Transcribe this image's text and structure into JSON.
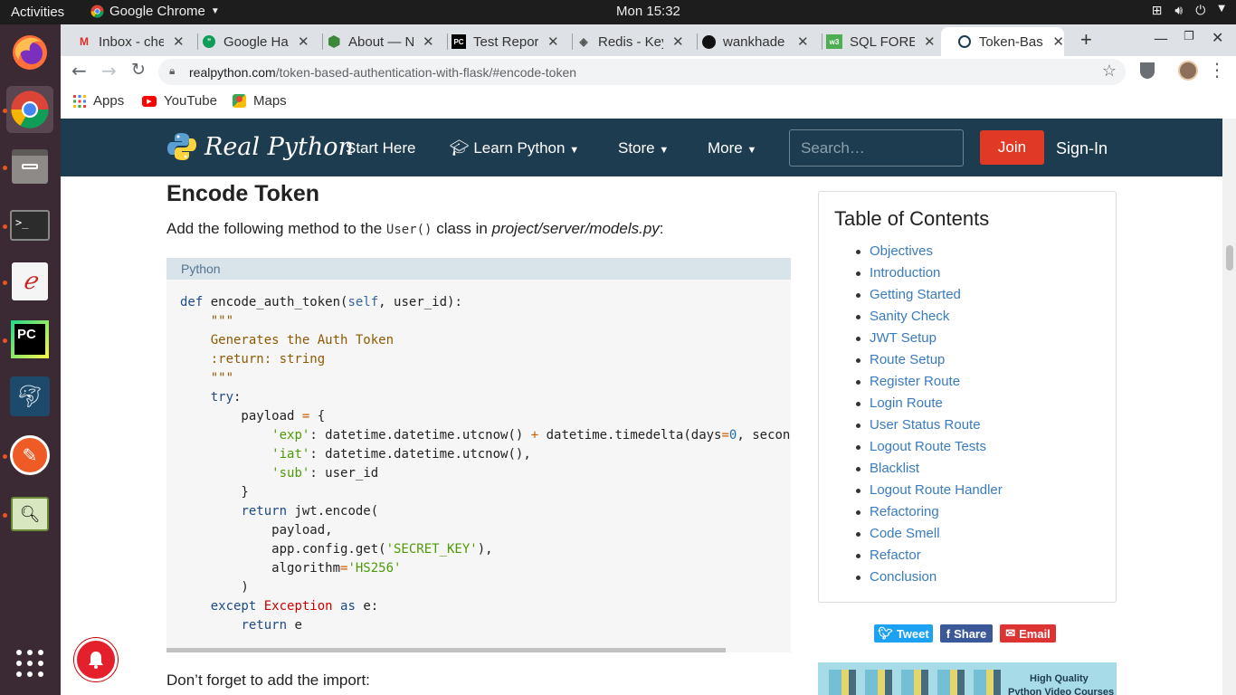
{
  "topbar": {
    "activities": "Activities",
    "app_name": "Google Chrome",
    "clock": "Mon 15:32"
  },
  "dock": {
    "items": [
      "firefox-icon",
      "chrome-icon",
      "files-icon",
      "terminal-icon",
      "document-viewer-icon",
      "pycharm-icon",
      "mysql-workbench-icon",
      "postman-icon",
      "image-viewer-icon",
      "show-apps-icon"
    ]
  },
  "tabs": [
    {
      "title": "Inbox - che",
      "icon": "gmail-icon"
    },
    {
      "title": "Google Ha",
      "icon": "hangouts-icon"
    },
    {
      "title": "About — N",
      "icon": "nodejs-icon"
    },
    {
      "title": "Test Repor",
      "icon": "pycharm-tab-icon"
    },
    {
      "title": "Redis - Key",
      "icon": "redis-icon"
    },
    {
      "title": "wankhade",
      "icon": "github-icon"
    },
    {
      "title": "SQL FORE",
      "icon": "w3schools-icon"
    },
    {
      "title": "Token-Bas",
      "icon": "realpython-tab-icon"
    }
  ],
  "address": {
    "host": "realpython.com",
    "path": "/token-based-authentication-with-flask/#encode-token"
  },
  "bookmarks": [
    "Apps",
    "YouTube",
    "Maps"
  ],
  "rpnav": {
    "logo": "Real Python",
    "links": [
      "Start Here",
      "Learn Python",
      "Store",
      "More"
    ],
    "search_placeholder": "Search…",
    "join": "Join",
    "signin": "Sign-In"
  },
  "article": {
    "heading": "Encode Token",
    "intro_prefix": "Add the following method to the ",
    "intro_code": "User()",
    "intro_mid": " class in ",
    "intro_path": "project/server/models.py",
    "intro_suffix": ":",
    "code_lang": "Python",
    "after": "Don’t forget to add the import:"
  },
  "toc": {
    "title": "Table of Contents",
    "items": [
      "Objectives",
      "Introduction",
      "Getting Started",
      "Sanity Check",
      "JWT Setup",
      "Route Setup",
      "Register Route",
      "Login Route",
      "User Status Route",
      "Logout Route Tests",
      "Blacklist",
      "Logout Route Handler",
      "Refactoring",
      "Code Smell",
      "Refactor",
      "Conclusion"
    ]
  },
  "share": {
    "tweet": "Tweet",
    "share": "Share",
    "email": "Email",
    "tweet_color": "#1da1f2",
    "share_color": "#3b5998",
    "email_color": "#dd3333"
  },
  "ad": {
    "line1": "High Quality",
    "line2": "Python Video Courses"
  },
  "colors": {
    "navbar": "#1e3c50",
    "join": "#e03a26",
    "link": "#3a7bbf"
  }
}
